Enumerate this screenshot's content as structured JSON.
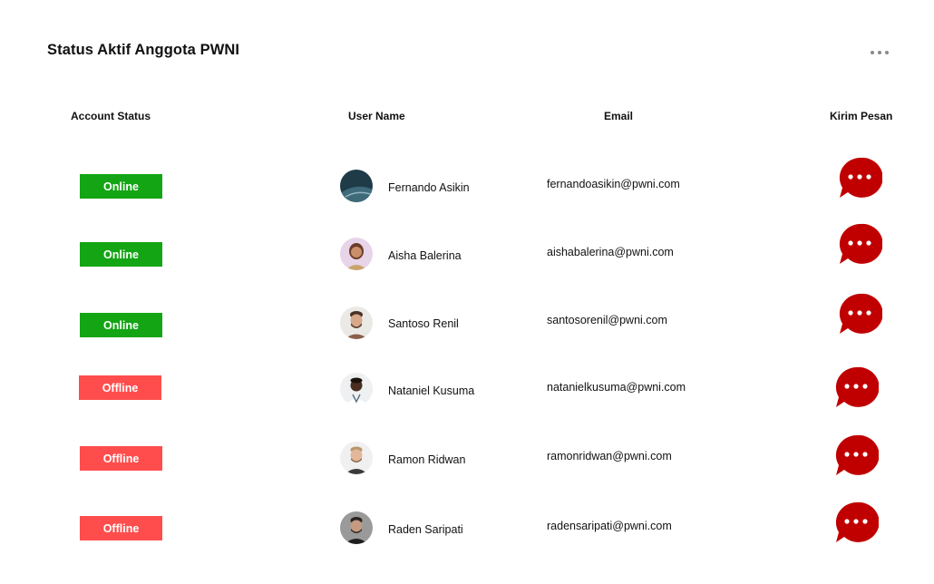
{
  "page": {
    "title": "Status Aktif Anggota PWNI",
    "more_icon": "more-horizontal-icon"
  },
  "columns": {
    "account_status": "Account Status",
    "user_name": "User Name",
    "email": "Email",
    "kirim_pesan": "Kirim Pesan"
  },
  "colors": {
    "online": "#14a514",
    "offline": "#ff4d4d",
    "message_bubble": "#c00000"
  },
  "rows": [
    {
      "status": "Online",
      "name": "Fernando Asikin",
      "email": "fernandoasikin@pwni.com",
      "action_icon": "chat-bubble-icon"
    },
    {
      "status": "Online",
      "name": "Aisha Balerina",
      "email": "aishabalerina@pwni.com",
      "action_icon": "chat-bubble-icon"
    },
    {
      "status": "Online",
      "name": "Santoso Renil",
      "email": "santosorenil@pwni.com",
      "action_icon": "chat-bubble-icon"
    },
    {
      "status": "Offline",
      "name": "Nataniel Kusuma",
      "email": "natanielkusuma@pwni.com",
      "action_icon": "chat-bubble-icon"
    },
    {
      "status": "Offline",
      "name": "Ramon Ridwan",
      "email": "ramonridwan@pwni.com",
      "action_icon": "chat-bubble-icon"
    },
    {
      "status": "Offline",
      "name": "Raden Saripati",
      "email": "radensaripati@pwni.com",
      "action_icon": "chat-bubble-icon"
    }
  ]
}
